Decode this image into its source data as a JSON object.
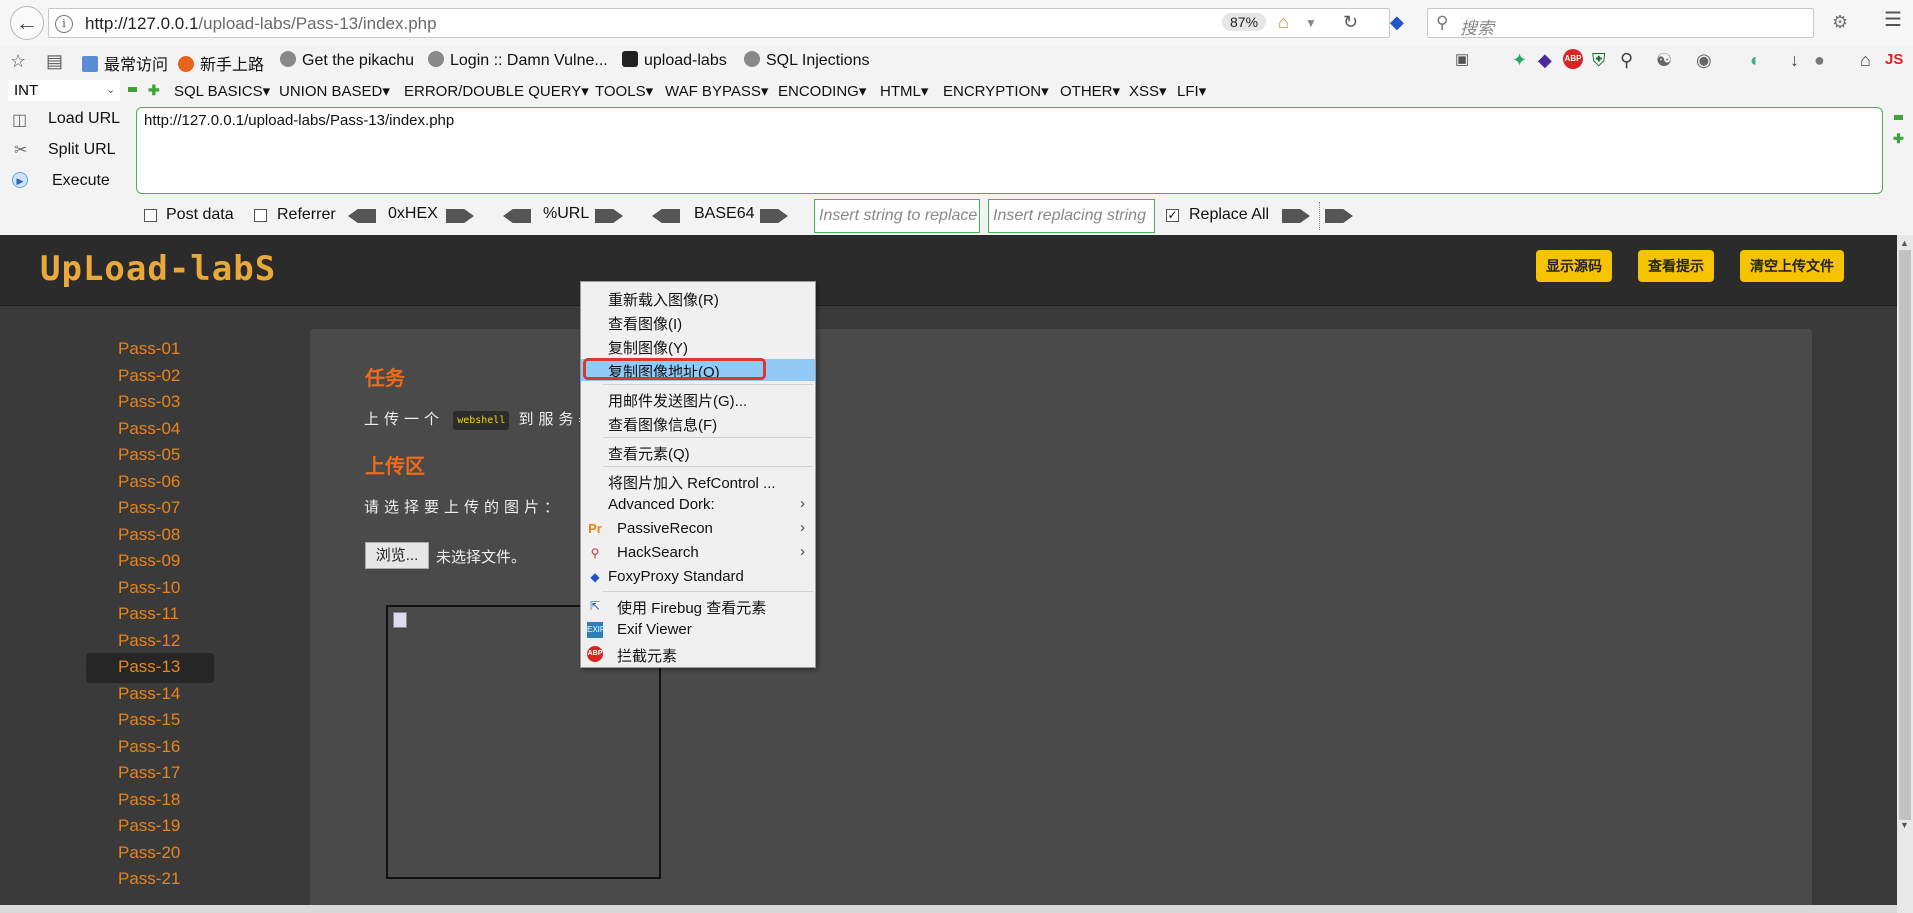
{
  "browser": {
    "url_host": "http://127.0.0.1",
    "url_rest": "/upload-labs/Pass-13/index.php",
    "zoom": "87%",
    "search_placeholder": "搜索"
  },
  "bookmarks": [
    "最常访问",
    "新手上路",
    "Get the pikachu",
    "Login :: Damn Vulne...",
    "upload-labs",
    "SQL Injections"
  ],
  "hackbar": {
    "type_select": "INT",
    "menu": [
      "SQL BASICS",
      "UNION BASED",
      "ERROR/DOUBLE QUERY",
      "TOOLS",
      "WAF BYPASS",
      "ENCODING",
      "HTML",
      "ENCRYPTION",
      "OTHER",
      "XSS",
      "LFI"
    ],
    "load_url": "Load URL",
    "split_url": "Split URL",
    "execute": "Execute",
    "url_value": "http://127.0.0.1/upload-labs/Pass-13/index.php",
    "post_data": "Post data",
    "referrer": "Referrer",
    "hex": "0xHEX",
    "urlenc": "%URL",
    "base64": "BASE64",
    "insert_placeholder": "Insert string to replace",
    "replacing_placeholder": "Insert replacing string",
    "replace_all": "Replace All"
  },
  "page": {
    "logo": "UpLoad-labS",
    "header_buttons": [
      "显示源码",
      "查看提示",
      "清空上传文件"
    ],
    "passes": [
      "Pass-01",
      "Pass-02",
      "Pass-03",
      "Pass-04",
      "Pass-05",
      "Pass-06",
      "Pass-07",
      "Pass-08",
      "Pass-09",
      "Pass-10",
      "Pass-11",
      "Pass-12",
      "Pass-13",
      "Pass-14",
      "Pass-15",
      "Pass-16",
      "Pass-17",
      "Pass-18",
      "Pass-19",
      "Pass-20",
      "Pass-21"
    ],
    "active_pass": "Pass-13",
    "task_title": "任务",
    "task_pre": "上传一个",
    "task_code": "webshell",
    "task_post": "到服务器",
    "upload_title": "上传区",
    "choose_label": "请选择要上传的图片：",
    "browse_button": "浏览...",
    "no_file": "未选择文件。"
  },
  "context_menu": {
    "items": [
      {
        "label": "重新载入图像(R)"
      },
      {
        "label": "查看图像(I)"
      },
      {
        "label": "复制图像(Y)"
      },
      {
        "label": "复制图像地址(O)",
        "highlighted": true
      },
      {
        "label": "用邮件发送图片(G)..."
      },
      {
        "label": "查看图像信息(F)"
      },
      {
        "label": "查看元素(Q)"
      },
      {
        "label": "将图片加入 RefControl ..."
      },
      {
        "label": "Advanced Dork:",
        "submenu": true
      },
      {
        "label": "PassiveRecon",
        "submenu": true,
        "icon": "passiverecon-icon"
      },
      {
        "label": "HackSearch",
        "submenu": true,
        "icon": "hacksearch-icon"
      },
      {
        "label": "FoxyProxy Standard",
        "icon": "foxyproxy-icon"
      },
      {
        "label": "使用 Firebug 查看元素",
        "icon": "firebug-icon"
      },
      {
        "label": "Exif Viewer",
        "icon": "exif-icon"
      },
      {
        "label": "拦截元素",
        "icon": "abp-icon"
      }
    ]
  },
  "colors": {
    "accent_orange": "#e8841a",
    "header_button": "#f5c300",
    "highlight": "#91c9f7",
    "ring": "#d93a2a"
  }
}
